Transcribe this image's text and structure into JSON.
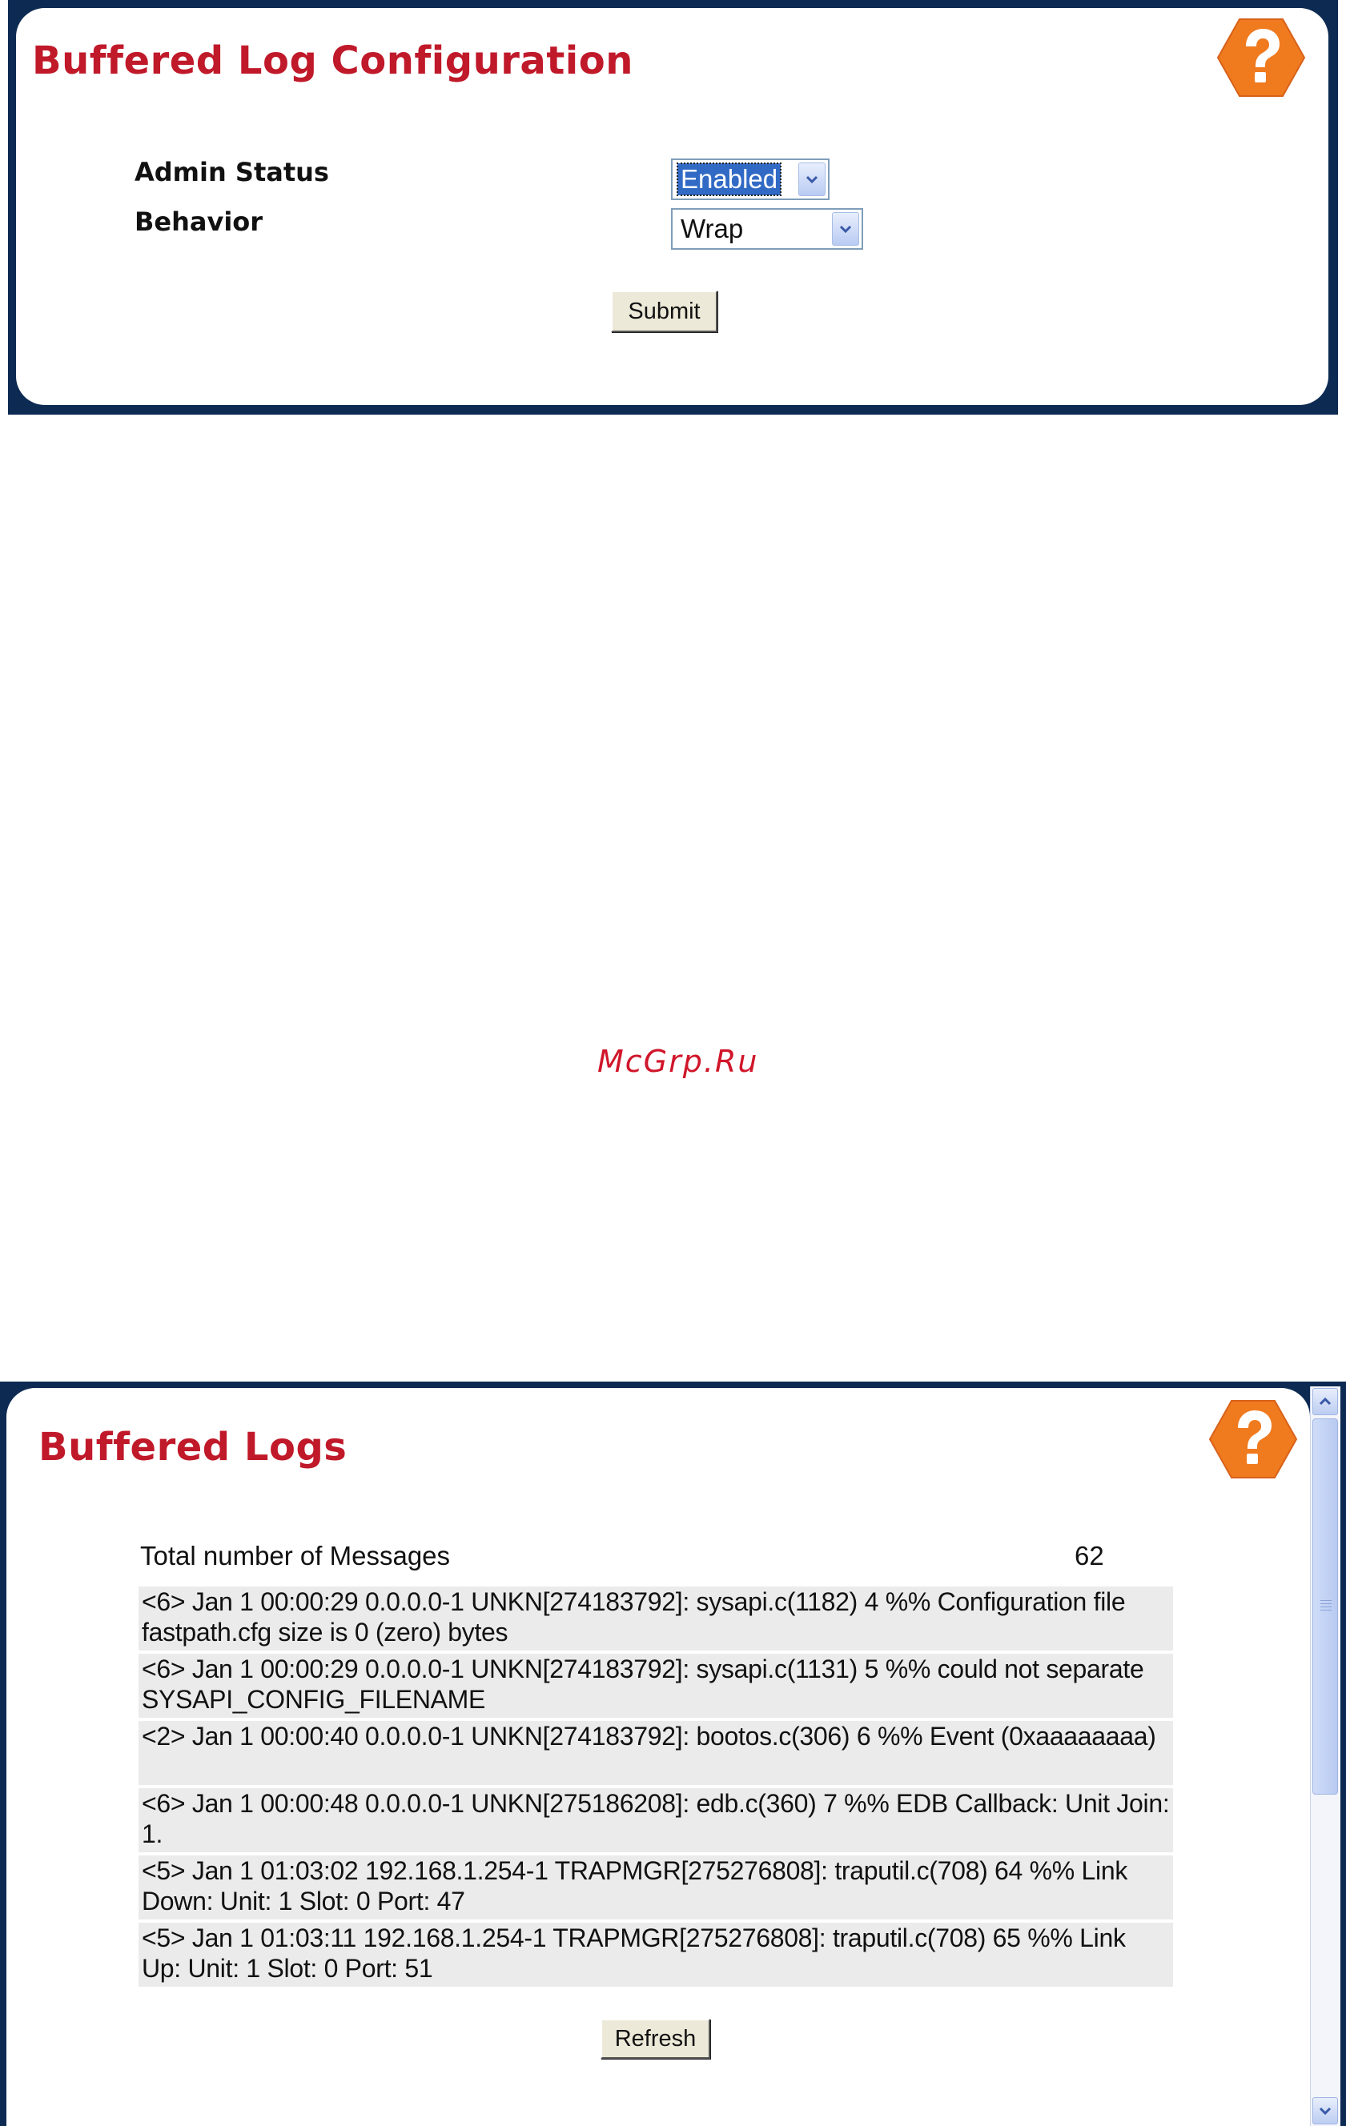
{
  "config_panel": {
    "title": "Buffered Log Configuration",
    "help_icon": "help-question-icon",
    "fields": [
      {
        "label": "Admin Status",
        "value": "Enabled"
      },
      {
        "label": "Behavior",
        "value": "Wrap"
      }
    ],
    "submit_label": "Submit"
  },
  "watermark": "McGrp.Ru",
  "logs_panel": {
    "title": "Buffered Logs",
    "help_icon": "help-question-icon",
    "total_label": "Total number of Messages",
    "total_value": "62",
    "entries": [
      "<6> Jan 1 00:00:29 0.0.0.0-1 UNKN[274183792]: sysapi.c(1182) 4 %% Configuration file fastpath.cfg size is 0 (zero) bytes",
      "<6> Jan 1 00:00:29 0.0.0.0-1 UNKN[274183792]: sysapi.c(1131) 5 %% could not separate SYSAPI_CONFIG_FILENAME",
      "<2> Jan 1 00:00:40 0.0.0.0-1 UNKN[274183792]: bootos.c(306) 6 %% Event (0xaaaaaaaa)",
      "<6> Jan 1 00:00:48 0.0.0.0-1 UNKN[275186208]: edb.c(360) 7 %% EDB Callback: Unit Join: 1.",
      "<5> Jan 1 01:03:02 192.168.1.254-1 TRAPMGR[275276808]: traputil.c(708) 64 %% Link Down: Unit: 1 Slot: 0 Port: 47",
      "<5> Jan 1 01:03:11 192.168.1.254-1 TRAPMGR[275276808]: traputil.c(708) 65 %% Link Up: Unit: 1 Slot: 0 Port: 51"
    ],
    "refresh_label": "Refresh"
  },
  "colors": {
    "frame": "#0d2a52",
    "title": "#c0192a",
    "help_orange": "#f07a1e",
    "row_bg": "#ebebeb"
  }
}
